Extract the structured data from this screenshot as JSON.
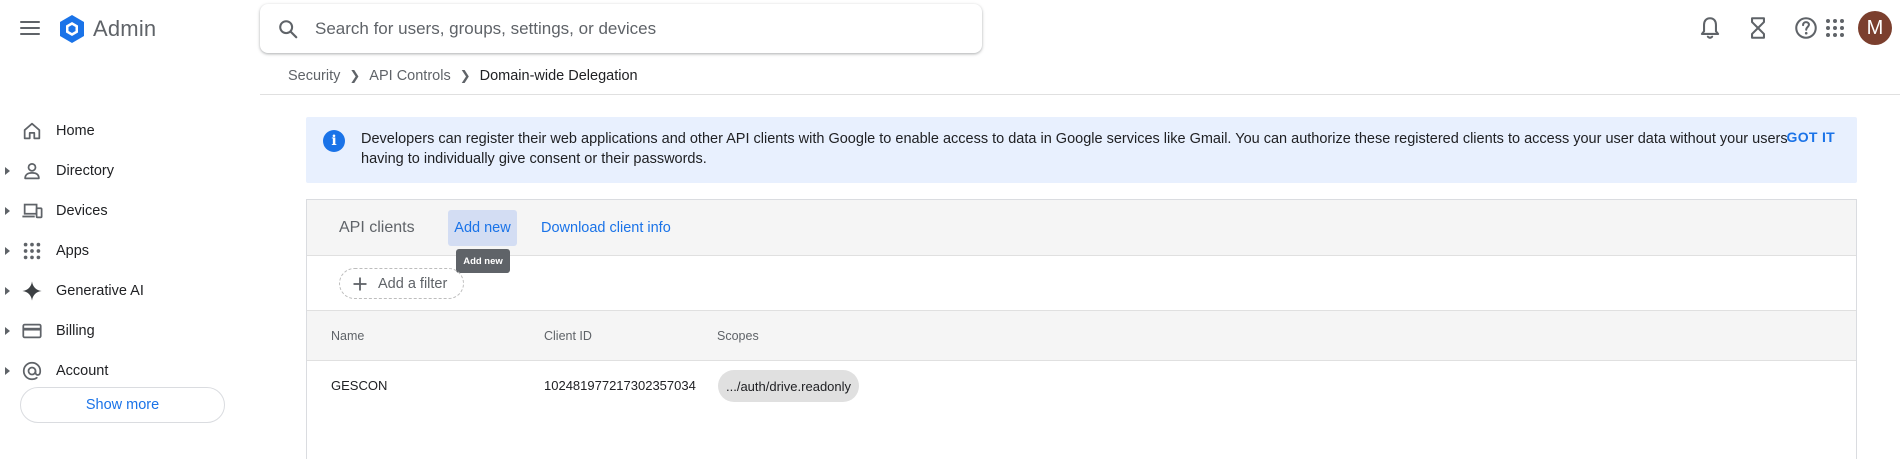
{
  "app": {
    "name": "Admin",
    "brand_color": "#1a73e8",
    "avatar_initial": "M",
    "avatar_color": "#7b3f2e"
  },
  "search": {
    "placeholder": "Search for users, groups, settings, or devices",
    "value": ""
  },
  "header_icons": [
    "notifications-bell-icon",
    "hourglass-icon",
    "help-icon",
    "apps-grid-icon"
  ],
  "breadcrumb": {
    "items": [
      "Security",
      "API Controls"
    ],
    "current": "Domain-wide Delegation"
  },
  "sidebar": {
    "items": [
      {
        "label": "Home",
        "icon": "home-icon",
        "expandable": false
      },
      {
        "label": "Directory",
        "icon": "person-icon",
        "expandable": true
      },
      {
        "label": "Devices",
        "icon": "devices-icon",
        "expandable": true
      },
      {
        "label": "Apps",
        "icon": "apps-grid-icon",
        "expandable": true
      },
      {
        "label": "Generative AI",
        "icon": "sparkle-icon",
        "expandable": true
      },
      {
        "label": "Billing",
        "icon": "credit-card-icon",
        "expandable": true
      },
      {
        "label": "Account",
        "icon": "at-sign-icon",
        "expandable": true
      }
    ],
    "show_more_label": "Show more"
  },
  "banner": {
    "text": "Developers can register their web applications and other API clients with Google to enable access to data in Google services like Gmail. You can authorize these registered clients to access your user data without your users having to individually give consent or their passwords.",
    "action_label": "GOT IT",
    "background": "#e8f0fe"
  },
  "card": {
    "title": "API clients",
    "add_new_label": "Add new",
    "download_label": "Download client info",
    "tooltip": "Add new",
    "filter_label": "Add a filter",
    "columns": [
      "Name",
      "Client ID",
      "Scopes"
    ],
    "rows": [
      {
        "name": "GESCON",
        "client_id": "102481977217302357034",
        "scope": ".../auth/drive.readonly"
      }
    ]
  }
}
